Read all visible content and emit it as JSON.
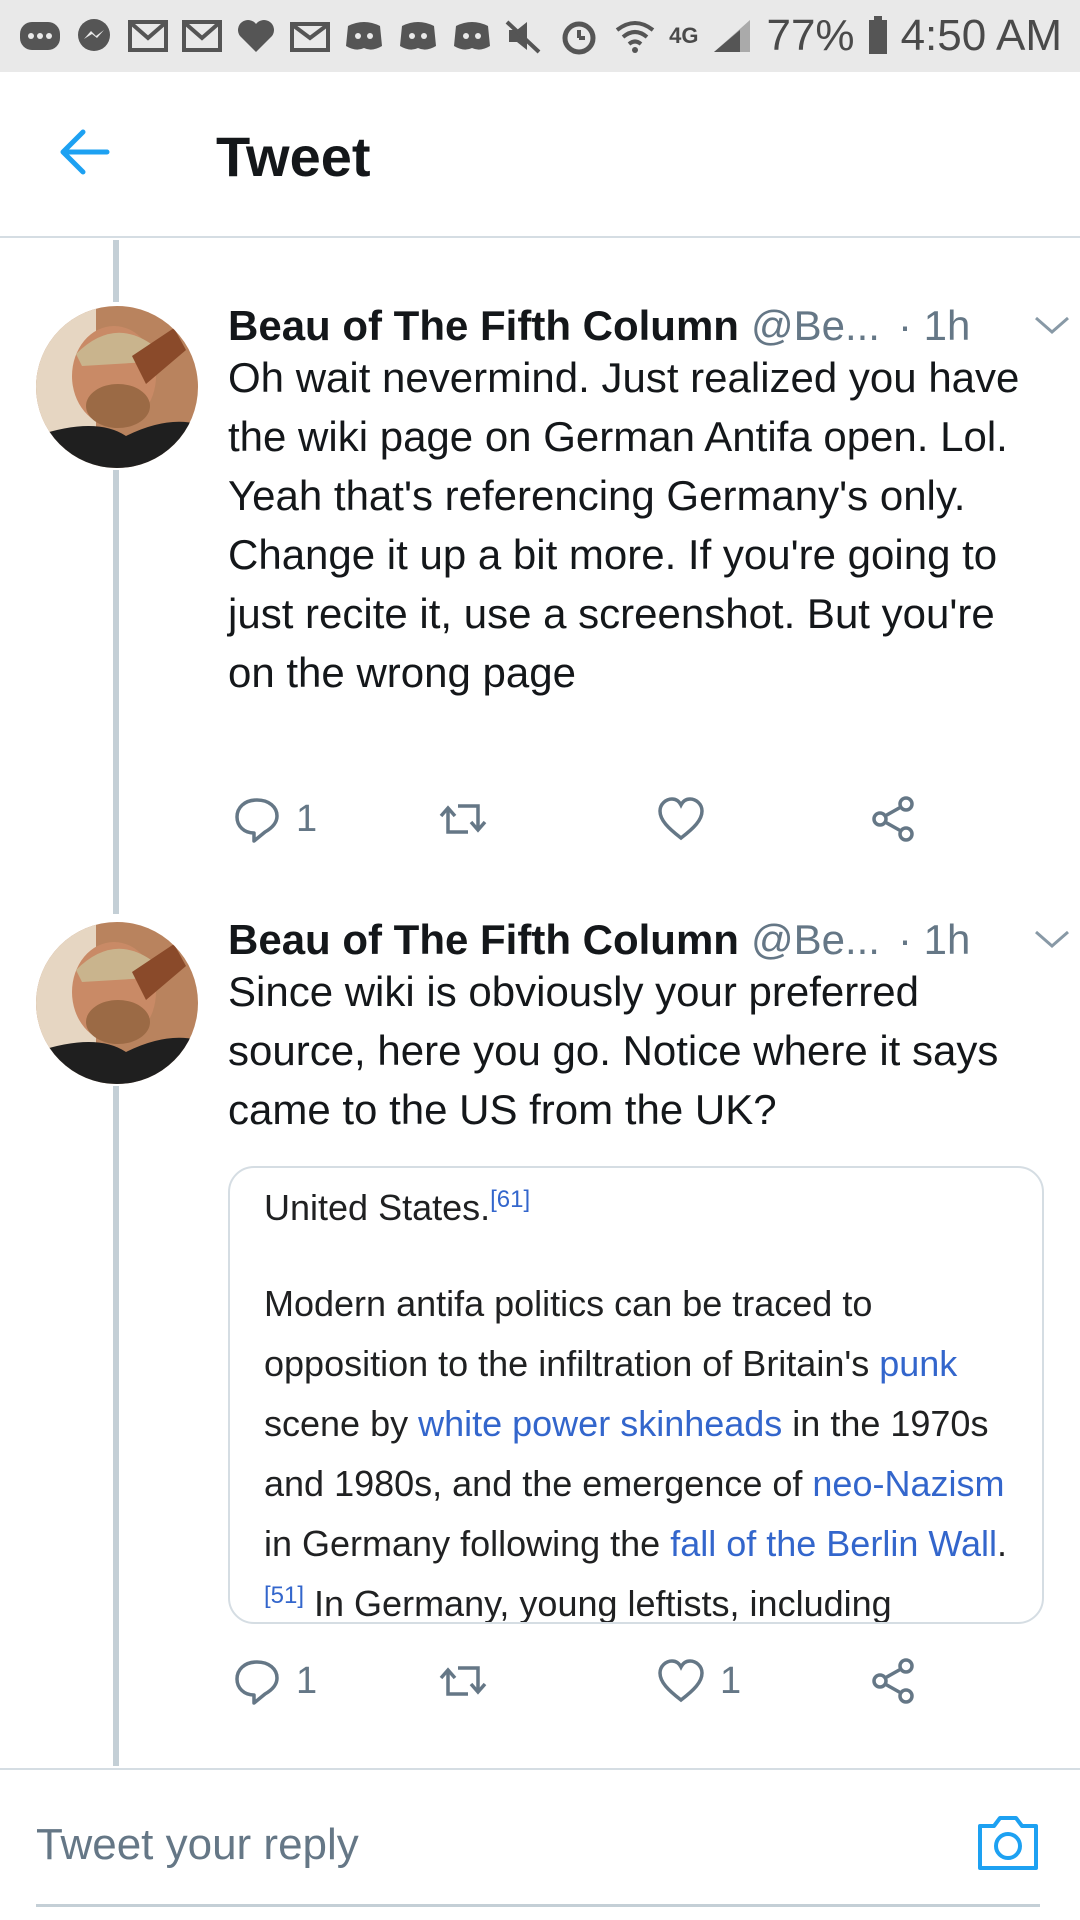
{
  "status_bar": {
    "battery": "77%",
    "time": "4:50 AM",
    "network": "4G"
  },
  "header": {
    "title": "Tweet"
  },
  "tweets": [
    {
      "name": "Beau of The Fifth Column",
      "handle": "@Be...",
      "time": "· 1h",
      "text": "Oh wait nevermind. Just realized you have the wiki page on German Antifa open. Lol. Yeah that's referencing Germany's only. Change it up a bit more. If you're going to just recite it, use a screenshot. But you're on the wrong page",
      "reply_count": "1",
      "retweet_count": "",
      "like_count": ""
    },
    {
      "name": "Beau of The Fifth Column",
      "handle": "@Be...",
      "time": "· 1h",
      "text": "Since wiki is obviously your preferred source, here you go. Notice where it says came to the US from the UK?",
      "reply_count": "1",
      "retweet_count": "",
      "like_count": "1",
      "image": {
        "line1_text": "United States.",
        "line1_ref": "[61]",
        "p2_a": "Modern antifa politics can be traced to opposition to the infiltration of Britain's ",
        "p2_link1": "punk",
        "p2_b": " scene by ",
        "p2_link2": "white power skinheads",
        "p2_c": " in the 1970s and 1980s, and the emergence of ",
        "p2_link3": "neo-Nazism",
        "p2_d": " in Germany following the ",
        "p2_link4": "fall of the Berlin Wall",
        "p2_e": ".",
        "p2_ref": "[51]",
        "p2_f": " In Germany, young leftists, including"
      }
    }
  ],
  "reply_bar": {
    "placeholder": "Tweet your reply"
  },
  "colors": {
    "accent": "#1da1f2",
    "secondary_text": "#657786",
    "link": "#3366cc",
    "divider": "#d5dde3"
  },
  "icons": [
    "back-arrow-icon",
    "chevron-down-icon",
    "reply-icon",
    "retweet-icon",
    "like-icon",
    "share-icon",
    "camera-icon"
  ]
}
